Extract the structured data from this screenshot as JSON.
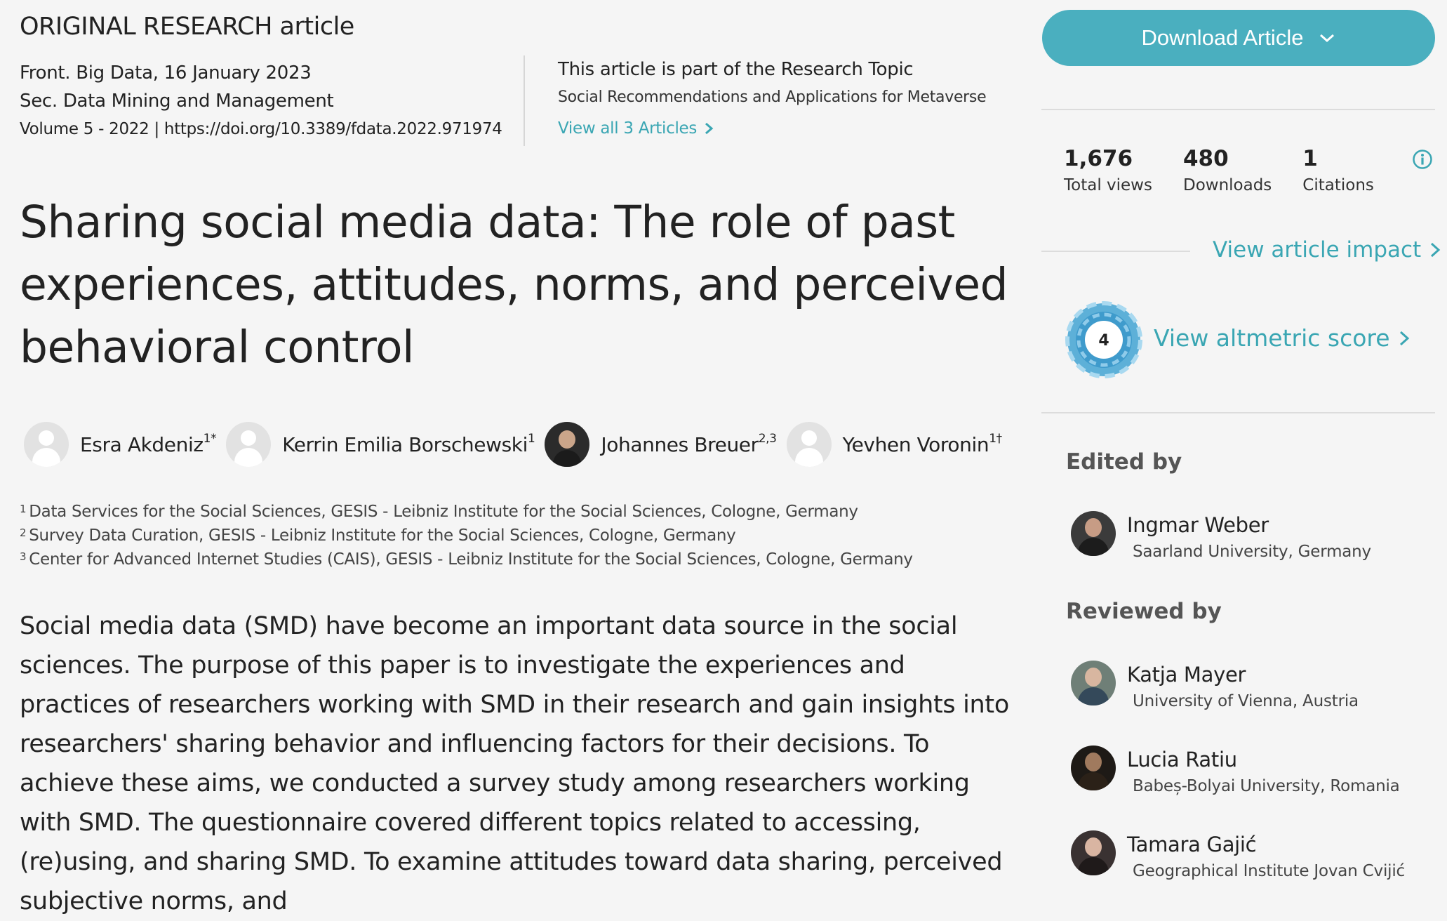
{
  "article_type": "ORIGINAL RESEARCH article",
  "meta": {
    "journal_date": "Front. Big Data, 16 January 2023",
    "section": "Sec. Data Mining and Management",
    "volume": "Volume 5 - 2022 |",
    "doi": "https://doi.org/10.3389/fdata.2022.971974"
  },
  "research_topic": {
    "intro": "This article is part of the Research Topic",
    "name": "Social Recommendations and Applications for Metaverse",
    "view_all": "View all 3 Articles"
  },
  "title": "Sharing social media data: The role of past experiences, attitudes, norms, and perceived behavioral control",
  "authors": [
    {
      "name": "Esra Akdeniz",
      "sup": "1*"
    },
    {
      "name": "Kerrin Emilia Borschewski",
      "sup": "1"
    },
    {
      "name": "Johannes Breuer",
      "sup": "2,3"
    },
    {
      "name": "Yevhen Voronin",
      "sup": "1†"
    }
  ],
  "affiliations": [
    {
      "num": "1",
      "text": "Data Services for the Social Sciences, GESIS - Leibniz Institute for the Social Sciences, Cologne, Germany"
    },
    {
      "num": "2",
      "text": "Survey Data Curation, GESIS - Leibniz Institute for the Social Sciences, Cologne, Germany"
    },
    {
      "num": "3",
      "text": "Center for Advanced Internet Studies (CAIS), GESIS - Leibniz Institute for the Social Sciences, Cologne, Germany"
    }
  ],
  "abstract": "Social media data (SMD) have become an important data source in the social sciences. The purpose of this paper is to investigate the experiences and practices of researchers working with SMD in their research and gain insights into researchers' sharing behavior and influencing factors for their decisions. To achieve these aims, we conducted a survey study among researchers working with SMD. The questionnaire covered different topics related to accessing, (re)using, and sharing SMD. To examine attitudes toward data sharing, perceived subjective norms, and",
  "sidebar": {
    "download_label": "Download Article",
    "stats": [
      {
        "value": "1,676",
        "label": "Total views"
      },
      {
        "value": "480",
        "label": "Downloads"
      },
      {
        "value": "1",
        "label": "Citations"
      }
    ],
    "view_impact": "View article impact",
    "altmetric_score": "4",
    "view_altmetric": "View altmetric score",
    "edited_by_heading": "Edited by",
    "editors": [
      {
        "name": "Ingmar Weber",
        "affiliation": "Saarland University, Germany"
      }
    ],
    "reviewed_by_heading": "Reviewed by",
    "reviewers": [
      {
        "name": "Katja Mayer",
        "affiliation": "University of Vienna, Austria"
      },
      {
        "name": "Lucia Ratiu",
        "affiliation": "Babeș-Bolyai University, Romania"
      },
      {
        "name": "Tamara Gajić",
        "affiliation": "Geographical Institute Jovan Cvijić"
      }
    ]
  },
  "colors": {
    "accent": "#4aafbf",
    "link": "#3aa6b3"
  }
}
